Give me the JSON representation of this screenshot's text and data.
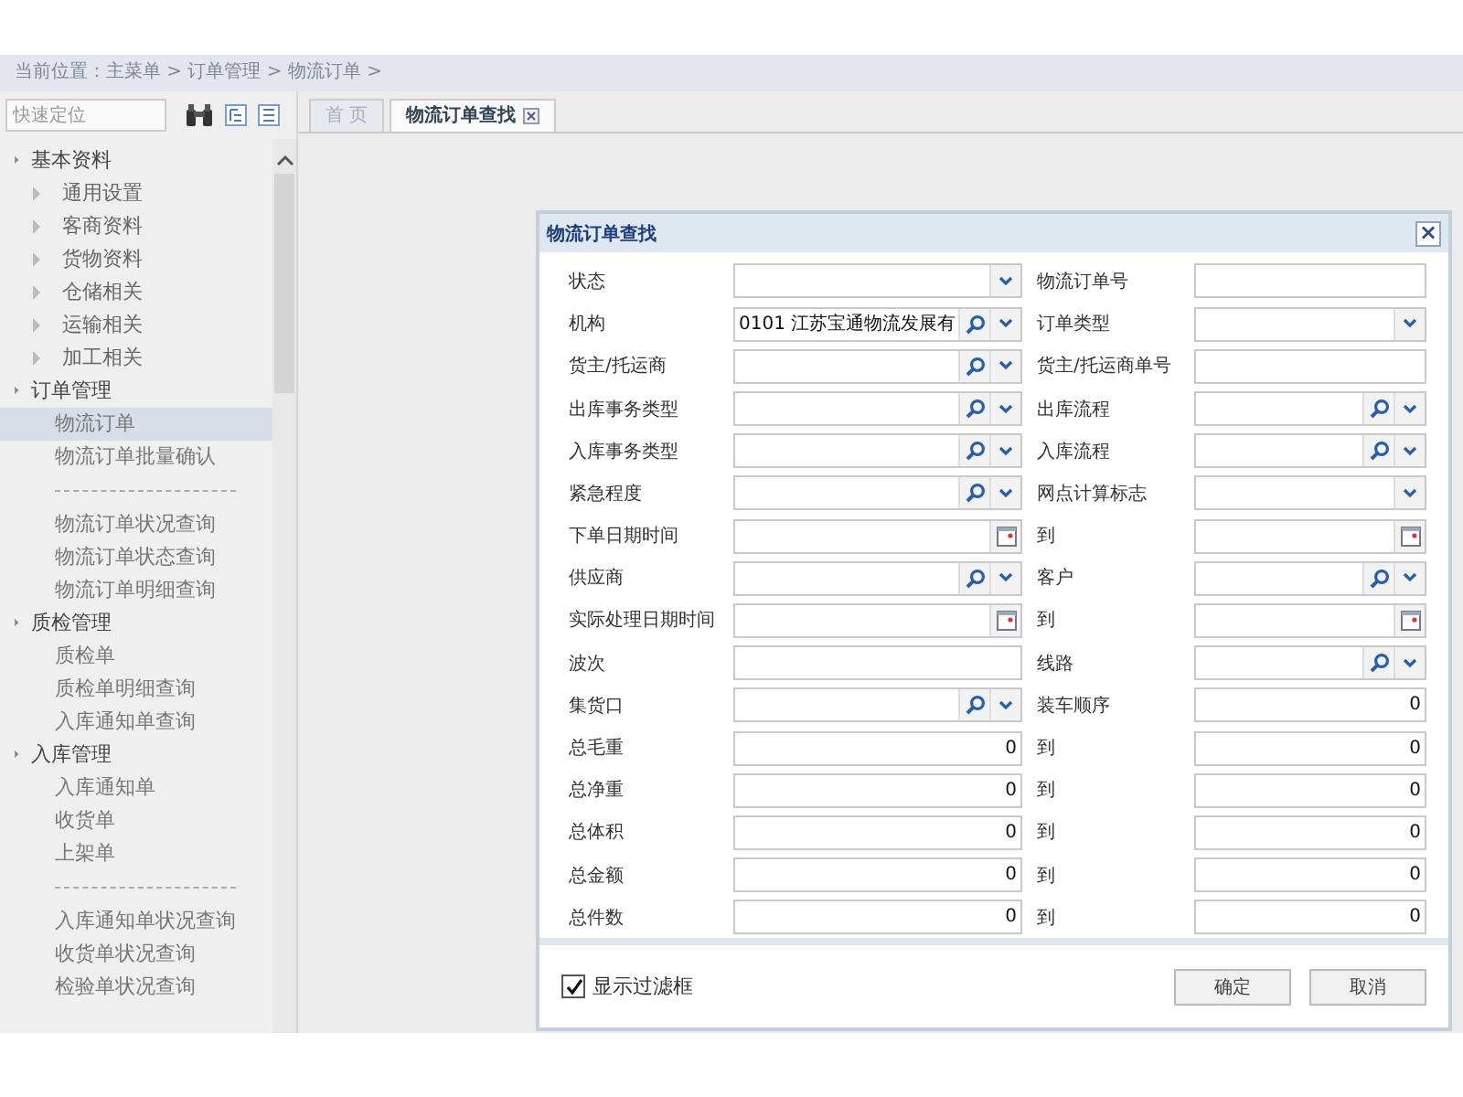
{
  "breadcrumb": "当前位置：主菜单 > 订单管理 > 物流订单 >",
  "sidebar": {
    "search": {
      "placeholder": "快速定位"
    },
    "groups": [
      {
        "label": "基本资料",
        "expanded": true,
        "children": [
          {
            "kind": "folder",
            "label": "通用设置",
            "expanded": false
          },
          {
            "kind": "folder",
            "label": "客商资料",
            "expanded": false
          },
          {
            "kind": "folder",
            "label": "货物资料",
            "expanded": false
          },
          {
            "kind": "folder",
            "label": "仓储相关",
            "expanded": false
          },
          {
            "kind": "folder",
            "label": "运输相关",
            "expanded": false
          },
          {
            "kind": "folder",
            "label": "加工相关",
            "expanded": false
          }
        ]
      },
      {
        "label": "订单管理",
        "expanded": true,
        "children": [
          {
            "kind": "link",
            "label": "物流订单",
            "selected": true
          },
          {
            "kind": "link",
            "label": "物流订单批量确认",
            "selected": false
          },
          {
            "kind": "separator"
          },
          {
            "kind": "link",
            "label": "物流订单状况查询",
            "selected": false
          },
          {
            "kind": "link",
            "label": "物流订单状态查询",
            "selected": false
          },
          {
            "kind": "link",
            "label": "物流订单明细查询",
            "selected": false
          }
        ]
      },
      {
        "label": "质检管理",
        "expanded": true,
        "children": [
          {
            "kind": "link",
            "label": "质检单",
            "selected": false
          },
          {
            "kind": "link",
            "label": "质检单明细查询",
            "selected": false
          },
          {
            "kind": "link",
            "label": "入库通知单查询",
            "selected": false
          }
        ]
      },
      {
        "label": "入库管理",
        "expanded": true,
        "children": [
          {
            "kind": "link",
            "label": "入库通知单",
            "selected": false
          },
          {
            "kind": "link",
            "label": "收货单",
            "selected": false
          },
          {
            "kind": "link",
            "label": "上架单",
            "selected": false
          },
          {
            "kind": "separator"
          },
          {
            "kind": "link",
            "label": "入库通知单状况查询",
            "selected": false
          },
          {
            "kind": "link",
            "label": "收货单状况查询",
            "selected": false
          },
          {
            "kind": "link",
            "label": "检验单状况查询",
            "selected": false
          }
        ]
      }
    ]
  },
  "tabs": [
    {
      "label": "首 页",
      "selected": false,
      "closable": false
    },
    {
      "label": "物流订单查找",
      "selected": true,
      "closable": true
    }
  ],
  "dialog": {
    "title": "物流订单查找",
    "close": "×",
    "rows": [
      [
        {
          "label": "状态",
          "kind": "combo"
        },
        {
          "label": "物流订单号",
          "kind": "text"
        }
      ],
      [
        {
          "label": "机构",
          "kind": "lookup",
          "value": "0101 江苏宝通物流发展有"
        },
        {
          "label": "订单类型",
          "kind": "combo"
        }
      ],
      [
        {
          "label": "货主/托运商",
          "kind": "lookup"
        },
        {
          "label": "货主/托运商单号",
          "kind": "text"
        }
      ],
      [
        {
          "label": "出库事务类型",
          "kind": "lookup"
        },
        {
          "label": "出库流程",
          "kind": "lookup"
        }
      ],
      [
        {
          "label": "入库事务类型",
          "kind": "lookup"
        },
        {
          "label": "入库流程",
          "kind": "lookup"
        }
      ],
      [
        {
          "label": "紧急程度",
          "kind": "lookup"
        },
        {
          "label": "网点计算标志",
          "kind": "combo"
        }
      ],
      [
        {
          "label": "下单日期时间",
          "kind": "date"
        },
        {
          "label": "到",
          "kind": "date"
        }
      ],
      [
        {
          "label": "供应商",
          "kind": "lookup"
        },
        {
          "label": "客户",
          "kind": "lookup"
        }
      ],
      [
        {
          "label": "实际处理日期时间",
          "kind": "date"
        },
        {
          "label": "到",
          "kind": "date"
        }
      ],
      [
        {
          "label": "波次",
          "kind": "text"
        },
        {
          "label": "线路",
          "kind": "lookup"
        }
      ],
      [
        {
          "label": "集货口",
          "kind": "lookup"
        },
        {
          "label": "装车顺序",
          "kind": "number",
          "value": "0"
        }
      ],
      [
        {
          "label": "总毛重",
          "kind": "number",
          "value": "0"
        },
        {
          "label": "到",
          "kind": "number",
          "value": "0"
        }
      ],
      [
        {
          "label": "总净重",
          "kind": "number",
          "value": "0"
        },
        {
          "label": "到",
          "kind": "number",
          "value": "0"
        }
      ],
      [
        {
          "label": "总体积",
          "kind": "number",
          "value": "0"
        },
        {
          "label": "到",
          "kind": "number",
          "value": "0"
        }
      ],
      [
        {
          "label": "总金额",
          "kind": "number",
          "value": "0"
        },
        {
          "label": "到",
          "kind": "number",
          "value": "0"
        }
      ],
      [
        {
          "label": "总件数",
          "kind": "number",
          "value": "0"
        },
        {
          "label": "到",
          "kind": "number",
          "value": "0"
        }
      ]
    ],
    "show_filter": {
      "label": "显示过滤框",
      "checked": true
    },
    "buttons": [
      "确定",
      "取消"
    ]
  }
}
